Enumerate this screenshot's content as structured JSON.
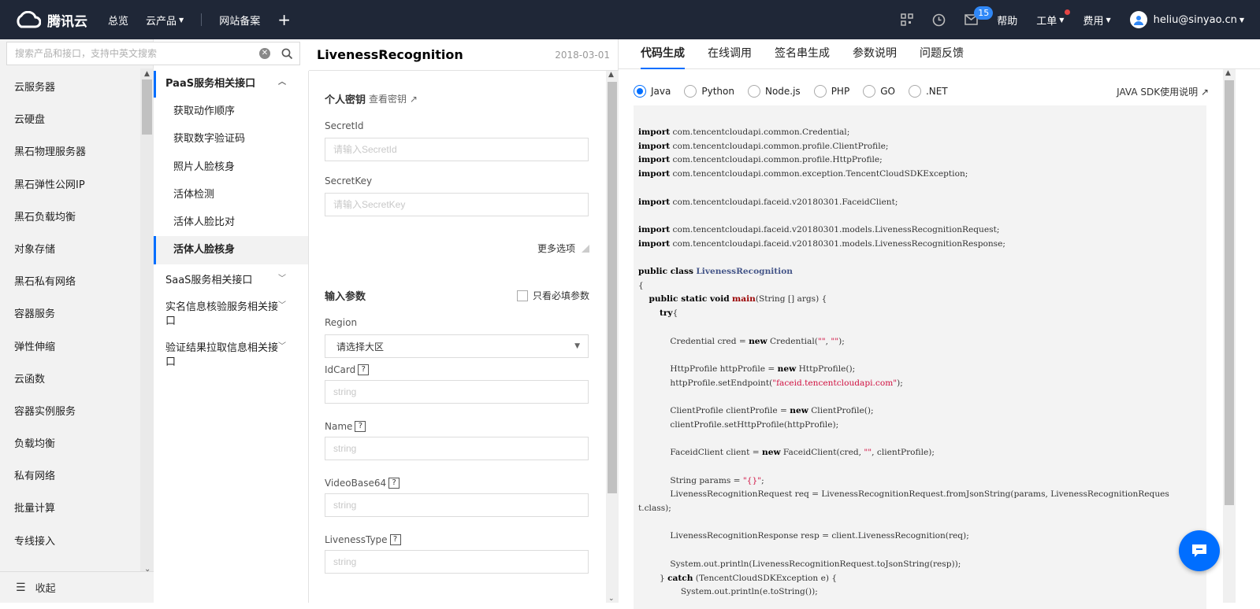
{
  "topbar": {
    "logo_text": "腾讯云",
    "nav": [
      "总览",
      "云产品",
      "网站备案"
    ],
    "badge_count": "15",
    "help": "帮助",
    "ticket": "工单",
    "billing": "费用",
    "user": "heliu@sinyao.cn"
  },
  "search": {
    "placeholder": "搜索产品和接口，支持中英文搜索"
  },
  "sidebar": {
    "items": [
      "云服务器",
      "云硬盘",
      "黑石物理服务器",
      "黑石弹性公网IP",
      "黑石负载均衡",
      "对象存储",
      "黑石私有网络",
      "容器服务",
      "弹性伸缩",
      "云函数",
      "容器实例服务",
      "负载均衡",
      "私有网络",
      "批量计算",
      "专线接入"
    ],
    "collapse": "收起"
  },
  "api_nav": {
    "group_paas": "PaaS服务相关接口",
    "subs": [
      "获取动作顺序",
      "获取数字验证码",
      "照片人脸核身",
      "活体检测",
      "活体人脸比对",
      "活体人脸核身"
    ],
    "group_saas": "SaaS服务相关接口",
    "group_realname": "实名信息核验服务相关接口",
    "group_result": "验证结果拉取信息相关接口"
  },
  "middle": {
    "title": "LivenessRecognition",
    "date": "2018-03-01",
    "secret_title": "个人密钥",
    "view_secret": "查看密钥",
    "secretid_label": "SecretId",
    "secretid_placeholder": "请输入SecretId",
    "secretkey_label": "SecretKey",
    "secretkey_placeholder": "请输入SecretKey",
    "more": "更多选项",
    "input_params": "输入参数",
    "required_only": "只看必填参数",
    "region_label": "Region",
    "region_value": "请选择大区",
    "fields": [
      {
        "label": "IdCard",
        "placeholder": "string"
      },
      {
        "label": "Name",
        "placeholder": "string"
      },
      {
        "label": "VideoBase64",
        "placeholder": "string"
      },
      {
        "label": "LivenessType",
        "placeholder": "string"
      }
    ]
  },
  "right": {
    "tabs": [
      "代码生成",
      "在线调用",
      "签名串生成",
      "参数说明",
      "问题反馈"
    ],
    "langs": [
      "Java",
      "Python",
      "Node.js",
      "PHP",
      "GO",
      ".NET"
    ],
    "sdk_link": "JAVA SDK使用说明"
  },
  "colors": {
    "accent": "#006eff",
    "topbar": "#1f2737"
  }
}
